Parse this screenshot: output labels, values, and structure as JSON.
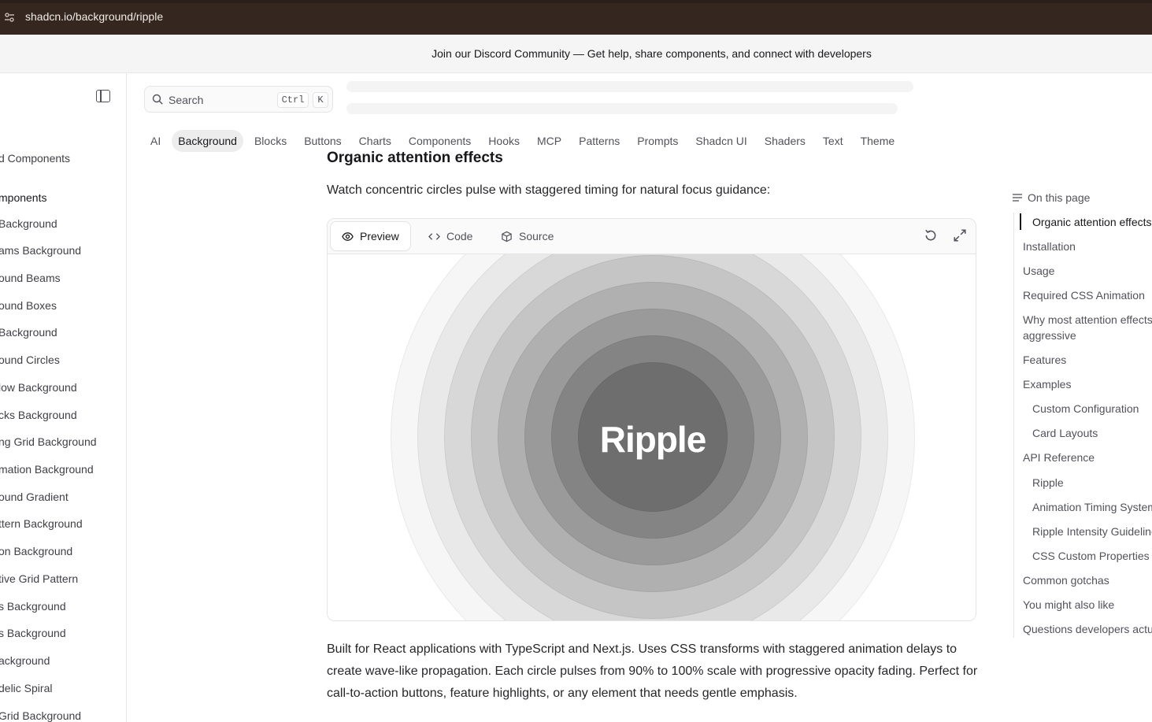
{
  "browser": {
    "url": "shadcn.io/background/ripple"
  },
  "announcement": {
    "text": "Join our Discord Community — Get help, share components, and connect with developers"
  },
  "sidebar": {
    "items": [
      {
        "label": "d Components",
        "section": false
      },
      {
        "label": "mponents",
        "section": true
      },
      {
        "label": " Background",
        "section": false
      },
      {
        "label": "ams Background",
        "section": false
      },
      {
        "label": "ound Beams",
        "section": false
      },
      {
        "label": "ound Boxes",
        "section": false
      },
      {
        "label": " Background",
        "section": false
      },
      {
        "label": "ound Circles",
        "section": false
      },
      {
        "label": "low Background",
        "section": false
      },
      {
        "label": "cks Background",
        "section": false
      },
      {
        "label": "ng Grid Background",
        "section": false
      },
      {
        "label": "mation Background",
        "section": false
      },
      {
        "label": "ound Gradient",
        "section": false
      },
      {
        "label": "ttern Background",
        "section": false
      },
      {
        "label": "on Background",
        "section": false
      },
      {
        "label": "tive Grid Pattern",
        "section": false
      },
      {
        "label": "s Background",
        "section": false
      },
      {
        "label": "s Background",
        "section": false
      },
      {
        "label": "ackground",
        "section": false
      },
      {
        "label": "delic Spiral",
        "section": false
      },
      {
        "label": "Grid Background",
        "section": false
      }
    ]
  },
  "search": {
    "placeholder": "Search",
    "shortcut_mod": "Ctrl",
    "shortcut_key": "K"
  },
  "categories": {
    "items": [
      "AI",
      "Background",
      "Blocks",
      "Buttons",
      "Charts",
      "Components",
      "Hooks",
      "MCP",
      "Patterns",
      "Prompts",
      "Shadcn UI",
      "Shaders",
      "Text",
      "Theme"
    ],
    "active": "Background"
  },
  "main": {
    "section_title": "Organic attention effects",
    "lead": "Watch concentric circles pulse with staggered timing for natural focus guidance:",
    "tabs": {
      "preview": "Preview",
      "code": "Code",
      "source": "Source"
    },
    "ripple_text": "Ripple",
    "body": "Built for React applications with TypeScript and Next.js. Uses CSS transforms with staggered animation delays to create wave-like propagation. Each circle pulses from 90% to 100% scale with progressive opacity fading. Perfect for call-to-action buttons, feature highlights, or any element that needs gentle emphasis."
  },
  "toc": {
    "title": "On this page",
    "items": [
      {
        "label": "Organic attention effects",
        "level": 2,
        "active": true
      },
      {
        "label": "Installation",
        "level": 1,
        "active": false
      },
      {
        "label": "Usage",
        "level": 1,
        "active": false
      },
      {
        "label": "Required CSS Animation",
        "level": 1,
        "active": false
      },
      {
        "label": "Why most attention effects",
        "level": 1,
        "active": false
      },
      {
        "label": "aggressive",
        "level": 1,
        "active": false
      },
      {
        "label": "Features",
        "level": 1,
        "active": false
      },
      {
        "label": "Examples",
        "level": 1,
        "active": false
      },
      {
        "label": "Custom Configuration",
        "level": 2,
        "active": false
      },
      {
        "label": "Card Layouts",
        "level": 2,
        "active": false
      },
      {
        "label": "API Reference",
        "level": 1,
        "active": false
      },
      {
        "label": "Ripple",
        "level": 2,
        "active": false
      },
      {
        "label": "Animation Timing System",
        "level": 2,
        "active": false
      },
      {
        "label": "Ripple Intensity Guidelines",
        "level": 2,
        "active": false
      },
      {
        "label": "CSS Custom Properties",
        "level": 2,
        "active": false
      },
      {
        "label": "Common gotchas",
        "level": 1,
        "active": false
      },
      {
        "label": "You might also like",
        "level": 1,
        "active": false
      },
      {
        "label": "Questions developers actu",
        "level": 1,
        "active": false
      }
    ]
  }
}
